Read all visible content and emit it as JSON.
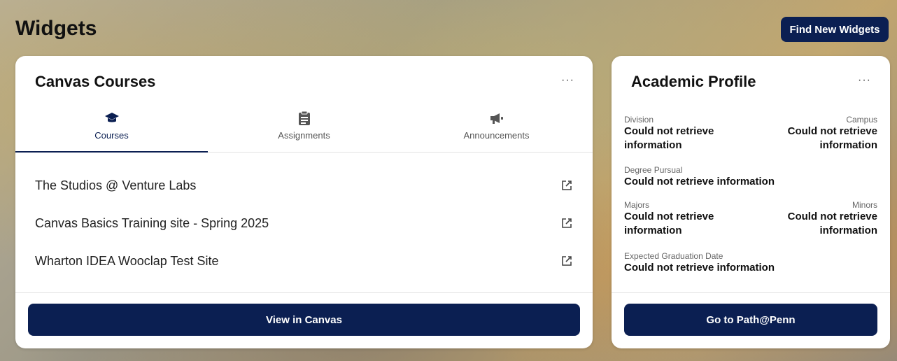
{
  "page": {
    "title": "Widgets",
    "find_button": "Find New Widgets"
  },
  "canvas_card": {
    "title": "Canvas Courses",
    "more_label": "···",
    "tabs": [
      {
        "label": "Courses",
        "icon": "graduation-cap-icon",
        "active": true
      },
      {
        "label": "Assignments",
        "icon": "clipboard-icon",
        "active": false
      },
      {
        "label": "Announcements",
        "icon": "megaphone-icon",
        "active": false
      }
    ],
    "courses": [
      {
        "name": "The Studios @ Venture Labs",
        "icon": "external-link-icon"
      },
      {
        "name": "Canvas Basics Training site - Spring 2025",
        "icon": "external-link-icon"
      },
      {
        "name": "Wharton IDEA Wooclap Test Site",
        "icon": "external-link-icon"
      }
    ],
    "button": "View in Canvas"
  },
  "profile_card": {
    "title": "Academic Profile",
    "more_label": "···",
    "division_label": "Division",
    "division_value": "Could not retrieve information",
    "campus_label": "Campus",
    "campus_value": "Could not retrieve information",
    "degree_label": "Degree Pursual",
    "degree_value": "Could not retrieve information",
    "majors_label": "Majors",
    "majors_value": "Could not retrieve information",
    "minors_label": "Minors",
    "minors_value": "Could not retrieve information",
    "grad_label": "Expected Graduation Date",
    "grad_value": "Could not retrieve information",
    "button": "Go to Path@Penn"
  },
  "colors": {
    "primary": "#0b1f52"
  }
}
